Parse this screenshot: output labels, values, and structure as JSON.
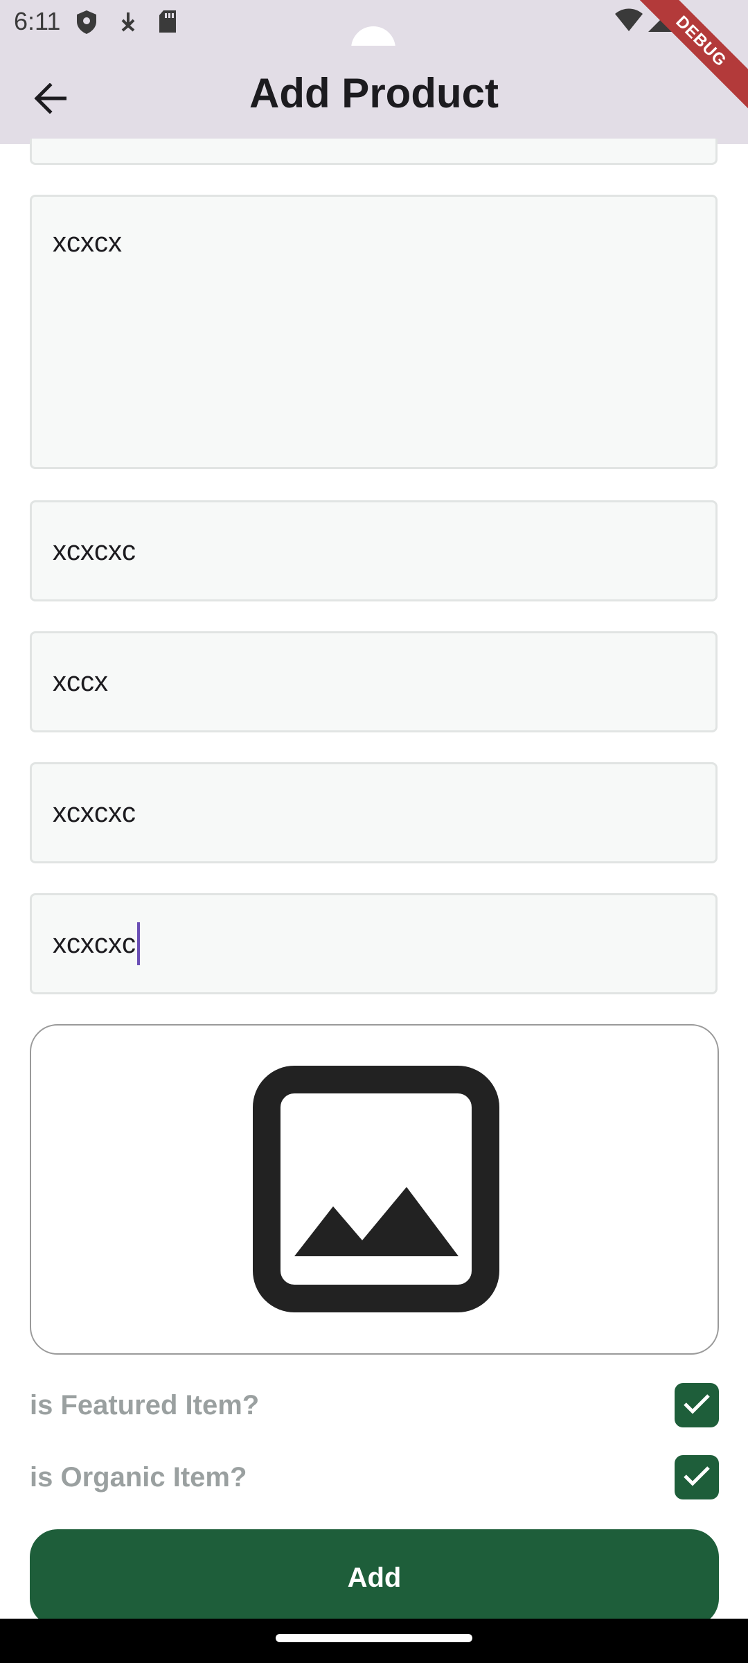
{
  "status_bar": {
    "time": "6:11"
  },
  "app_bar": {
    "title": "Add Product",
    "debug_label": "DEBUG"
  },
  "form": {
    "description_value": "xcxcx",
    "field_1_value": "xcxcxc",
    "field_2_value": "xccx",
    "field_3_value": "xcxcxc",
    "field_4_value": "xcxcxc"
  },
  "image_picker": {
    "icon": "image-placeholder-icon"
  },
  "options": {
    "featured_label": "is Featured Item?",
    "featured_checked": true,
    "organic_label": "is Organic Item?",
    "organic_checked": true
  },
  "actions": {
    "add_label": "Add"
  },
  "colors": {
    "app_bar": "#e2dde6",
    "primary": "#1e5e3a",
    "field_background": "#f7f9f8",
    "caret": "#6a4fb5"
  }
}
